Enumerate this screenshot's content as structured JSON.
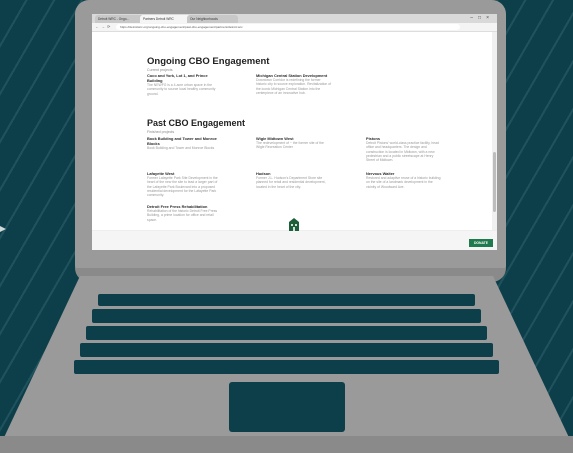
{
  "browser": {
    "tabs": [
      {
        "label": "Detroit WRC - Ongo..."
      },
      {
        "label": "Partners Detroit WRC"
      },
      {
        "label": "Our Neighborhoods"
      }
    ],
    "url": "https://detroitwrc.org/ongoing-cbo-engagement/past-cbo-engagement/partners/detroit-wrc"
  },
  "ongoing": {
    "title": "Ongoing CBO Engagement",
    "subtitle": "Current projects",
    "items": [
      {
        "title": "Coco and York, Lot 1, and Prince Building",
        "desc": "The NEWFG is a 4-acre urban space in the community to source local healthy community ground."
      },
      {
        "title": "Michigan Central Station Development",
        "desc": "Downtown Corridor is redefining the former historic city to source exploration. Revitalization of the iconic Michigan Central Station into the centerpiece of an innovative hub."
      }
    ]
  },
  "past": {
    "title": "Past CBO Engagement",
    "subtitle": "Finished projects",
    "items": [
      {
        "title": "Book Building and Tower and Monroe Blocks",
        "desc": "Book Building and Tower and Monroe Blocks"
      },
      {
        "title": "Wigle Midtown West",
        "desc": "The redevelopment of ~ the former site of the Wigle Recreation Center"
      },
      {
        "title": "Pistons",
        "desc": "Detroit Pistons' world-class practice facility, head office and headquarters. The design and construction is located in Midtown, with a new pedestrian and a public streetscape at Henry Street of Midtown."
      },
      {
        "title": "Lafayette West",
        "desc": "Former Lafayette Park Site Development in the heart of the new the site to lead a larger part of the Lafayette Park Boulevard into a proposed residential development for the Lafayette Park community."
      },
      {
        "title": "Hudson",
        "desc": "Former J.L. Hudson's Department Store site planned for retail and residential development, located in the heart of the city."
      },
      {
        "title": "Nervous Waiter",
        "desc": "Restored and adaptive reuse of a historic building on the site of a landmark development in the vicinity of Woodward Ave."
      },
      {
        "title": "Detroit Free Press Rehabilitation",
        "desc": "Rehabilitation of the historic Detroit Free Press Building, a prime location for office and retail space."
      }
    ]
  },
  "footer": {
    "logo_icon": "building-logo-icon",
    "donate_label": "DONATE"
  },
  "colors": {
    "background": "#0d3f4a",
    "laptop": "#9a9a9a",
    "accent": "#1f7a4d"
  }
}
